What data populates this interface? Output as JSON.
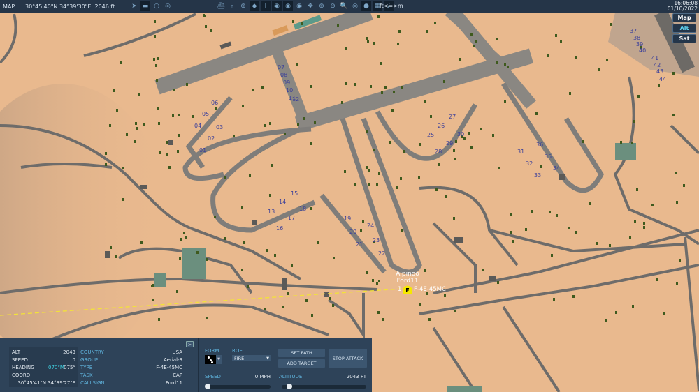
{
  "topbar": {
    "title": "MAP",
    "coordinates": "30°45'40\"N 34°39'30\"E, 2046 ft",
    "units": "ft<=>m",
    "time": "16:06:08",
    "date": "01/10/2022",
    "tools": [
      "navigate-icon",
      "toggle-icon",
      "circle-icon",
      "layers-icon",
      "ship-icon",
      "network-icon",
      "target-icon",
      "signal-icon",
      "tower-icon",
      "radar-1-icon",
      "radar-2-icon",
      "radar-3-icon",
      "move-icon",
      "zoom-in-icon",
      "zoom-out-icon",
      "zoom-fit-icon",
      "threat-rings-icon",
      "globe-icon",
      "grid-icon",
      "ruler-icon"
    ]
  },
  "map_modes": [
    "Map",
    "Alt",
    "Sat"
  ],
  "active_map_mode": "Alt",
  "shelters": [
    "01",
    "02",
    "03",
    "04",
    "05",
    "06",
    "07",
    "08",
    "09",
    "10",
    "11",
    "12",
    "13",
    "14",
    "15",
    "16",
    "17",
    "18",
    "19",
    "20",
    "21",
    "22",
    "23",
    "24",
    "25",
    "26",
    "27",
    "28",
    "29",
    "30",
    "31",
    "32",
    "33",
    "34",
    "35",
    "36",
    "37",
    "38",
    "39",
    "40",
    "41",
    "42",
    "43",
    "44"
  ],
  "unit": {
    "name": "Alpinoo",
    "callsign_label": "Ford11",
    "marker": "F",
    "count": "1",
    "type_label": "F-4E-45MC"
  },
  "info": {
    "expand": ">",
    "alt_label": "ALT",
    "alt": "2043",
    "speed_label": "SPEED",
    "speed": "0",
    "heading_label": "HEADING",
    "heading_mag": "070°M",
    "heading_true": "075°",
    "coord_label": "COORD",
    "coord": "30°45'41\"N 34°39'27\"E",
    "country_label": "COUNTRY",
    "country": "USA",
    "group_label": "GROUP",
    "group": "Aerial-3",
    "type_label": "TYPE",
    "type": "F-4E-45MC",
    "task_label": "TASK",
    "task": "CAP",
    "callsign_label": "CALLSIGN",
    "callsign": "Ford11"
  },
  "controls": {
    "form_label": "FORM",
    "roe_label": "ROE",
    "roe": "FIRE",
    "set_path": "SET PATH",
    "add_target": "ADD TARGET",
    "stop_attack": "STOP ATTACK",
    "speed_label": "SPEED",
    "speed": "0 MPH",
    "speed_fraction": 0,
    "altitude_label": "ALTITUDE",
    "altitude": "2043 FT",
    "altitude_fraction": 0.03
  }
}
